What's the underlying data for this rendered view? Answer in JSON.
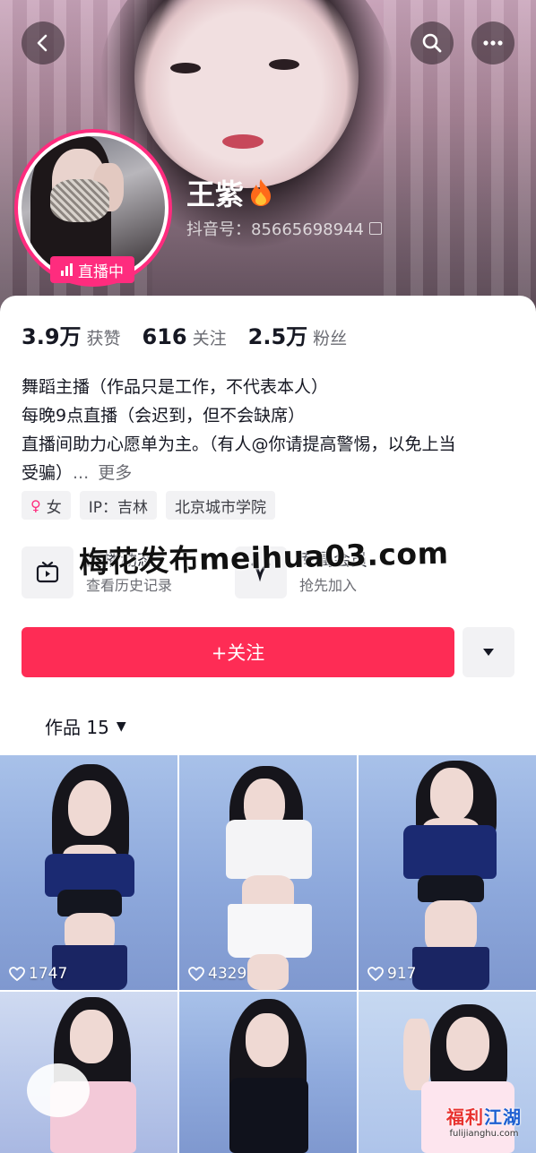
{
  "header": {
    "nickname": "王紫",
    "fire_icon": "fire-icon",
    "douyin_id": "抖音号：85665698944",
    "live_badge": "直播中",
    "accent": "#fe2c7e"
  },
  "stats": [
    {
      "num": "3.9万",
      "label": "获赞"
    },
    {
      "num": "616",
      "label": "关注"
    },
    {
      "num": "2.5万",
      "label": "粉丝"
    }
  ],
  "bio": {
    "line1": "舞蹈主播（作品只是工作，不代表本人）",
    "line2": "每晚9点直播（会迟到，但不会缺席）",
    "line3": "直播间助力心愿单为主。（有人@你请提高警惕，以免上当",
    "line4": "受骗）",
    "ellipsis": "...",
    "more": "更多"
  },
  "tags": {
    "gender": "女",
    "ip": "IP：吉林",
    "school": "北京城市学院"
  },
  "features": [
    {
      "title": "直播动态",
      "sub": "查看历史记录"
    },
    {
      "title": "专属会员",
      "sub": "抢先加入"
    }
  ],
  "watermark": "梅花发布meihua03.com",
  "follow": {
    "label": "+关注",
    "color": "#fe2c55"
  },
  "works_tab": {
    "label": "作品 15",
    "caret": "▼"
  },
  "videos": [
    {
      "likes": "1747"
    },
    {
      "likes": "4329"
    },
    {
      "likes": "917"
    }
  ],
  "logo": {
    "title_a": "福利",
    "title_b": "江湖",
    "url": "fulijianghu.com"
  }
}
